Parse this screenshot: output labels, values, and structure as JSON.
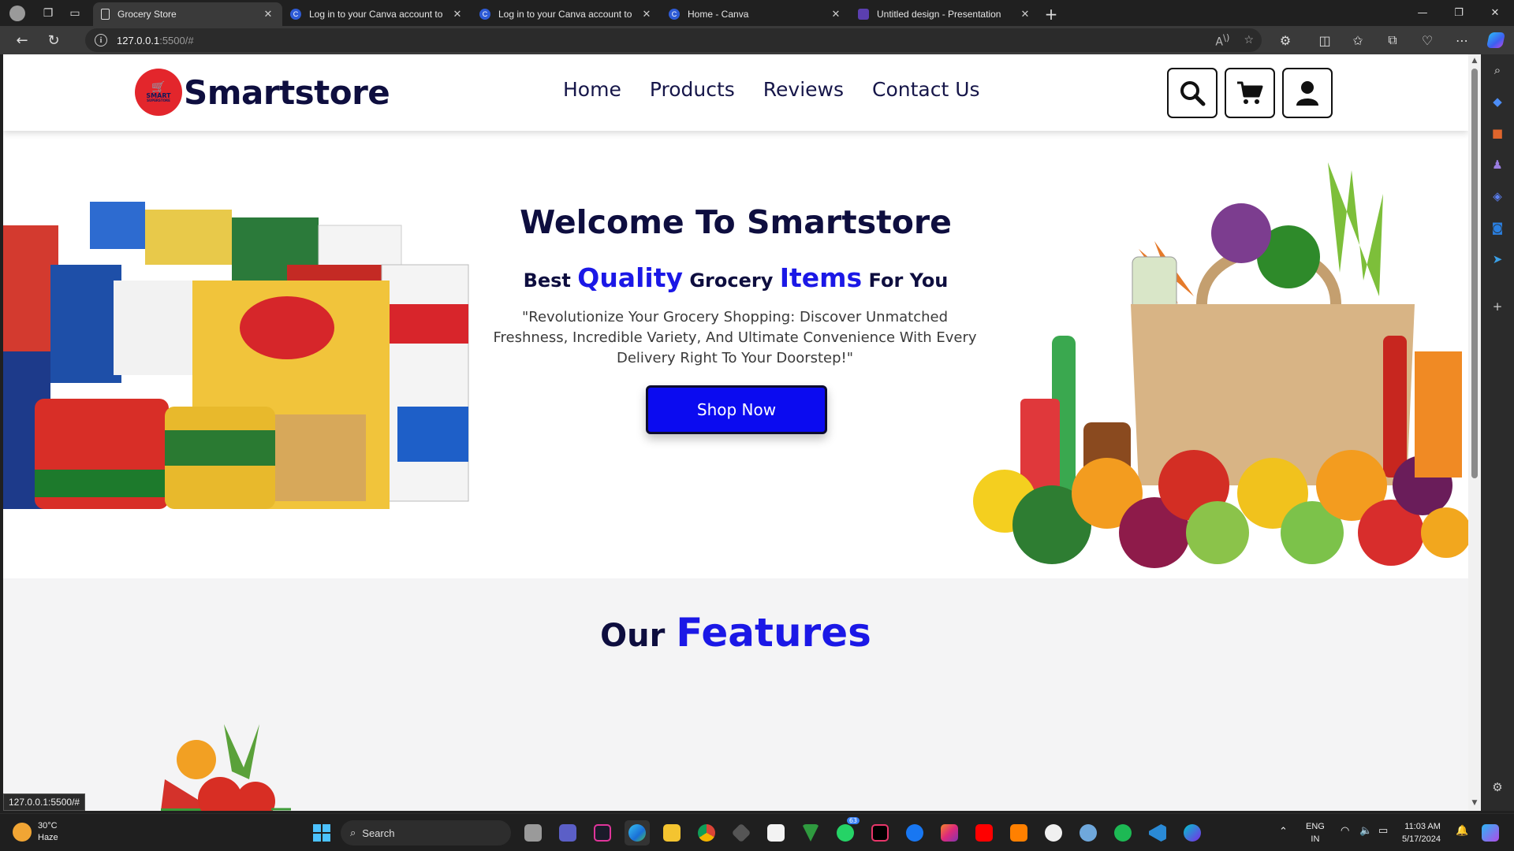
{
  "browser": {
    "tabs": [
      {
        "title": "Grocery Store",
        "active": true,
        "favicon": "document-icon"
      },
      {
        "title": "Log in to your Canva account to",
        "active": false,
        "favicon": "canva-icon"
      },
      {
        "title": "Log in to your Canva account to",
        "active": false,
        "favicon": "canva-icon"
      },
      {
        "title": "Home - Canva",
        "active": false,
        "favicon": "canva-icon"
      },
      {
        "title": "Untitled design - Presentation",
        "active": false,
        "favicon": "presentation-icon"
      }
    ],
    "url_host": "127.0.0.1",
    "url_path": ":5500/#",
    "status_url": "127.0.0.1:5500/#"
  },
  "site": {
    "logo_badge_line1": "SMART",
    "logo_badge_line2": "SUPERSTORE",
    "logo_text": "Smartstore",
    "nav": [
      "Home",
      "Products",
      "Reviews",
      "Contact Us"
    ],
    "hero": {
      "title": "Welcome To Smartstore",
      "sub_1": "Best ",
      "sub_2": "Quality",
      "sub_3": " Grocery ",
      "sub_4": "Items",
      "sub_5": " For You",
      "description": "\"Revolutionize Your Grocery Shopping: Discover Unmatched Freshness, Incredible Variety, And Ultimate Convenience With Every Delivery Right To Your Doorstep!\"",
      "cta": "Shop Now"
    },
    "features": {
      "title_1": "Our ",
      "title_2": "Features"
    },
    "colors": {
      "accent": "#1b18e6",
      "primary_dark": "#0e0e3f",
      "button": "#0b0bf0",
      "logo_red": "#e3262c"
    }
  },
  "taskbar": {
    "weather_temp": "30°C",
    "weather_desc": "Haze",
    "search_placeholder": "Search",
    "whatsapp_badge": "63",
    "lang_1": "ENG",
    "lang_2": "IN",
    "time": "11:03 AM",
    "date": "5/17/2024"
  }
}
